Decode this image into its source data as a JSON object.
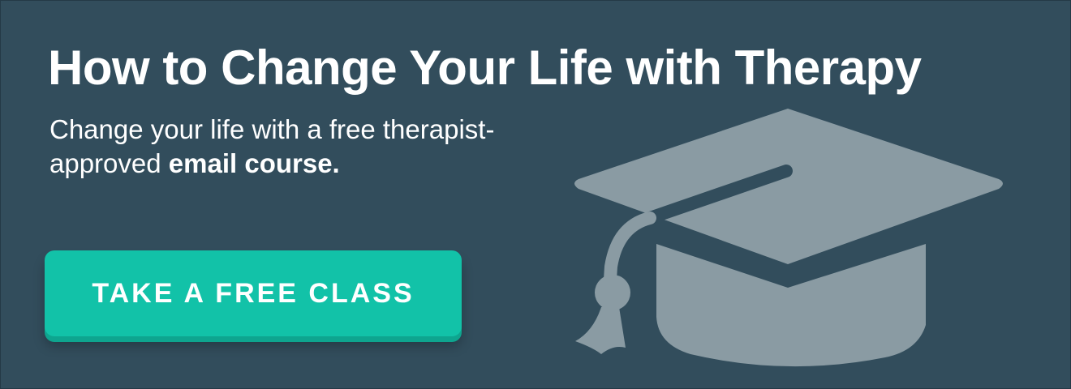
{
  "banner": {
    "title": "How to Change Your Life with Therapy",
    "subtitle_regular": "Change your life with a free therapist-approved ",
    "subtitle_bold": "email course.",
    "cta_label": "TAKE A FREE CLASS",
    "icon": "graduation-cap-icon"
  },
  "colors": {
    "background": "#324d5c",
    "button": "#12c2a8",
    "icon": "#8a9ba3",
    "text": "#ffffff"
  }
}
